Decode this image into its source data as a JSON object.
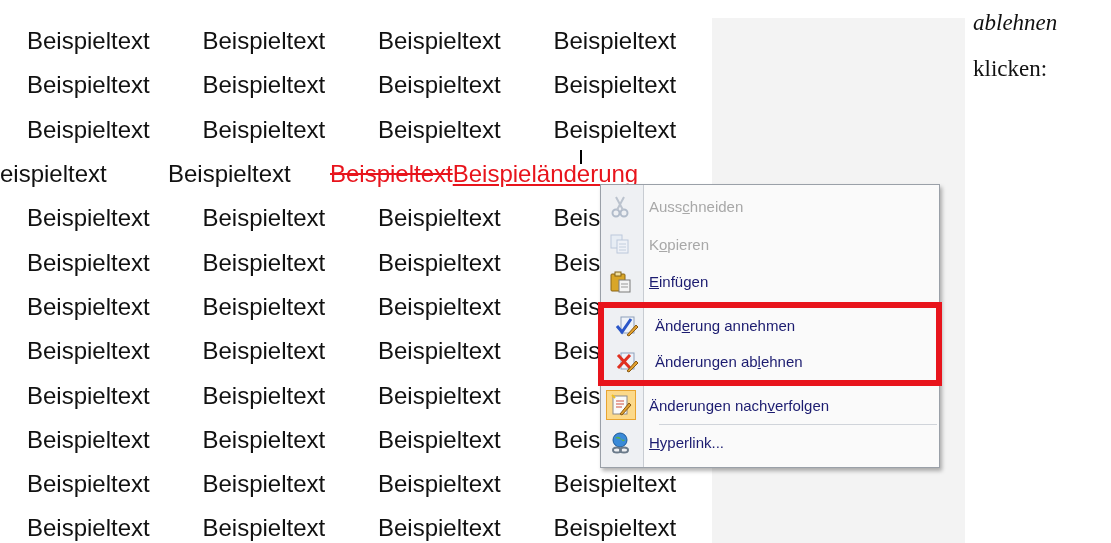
{
  "document": {
    "rows": [
      {
        "kind": "grid",
        "words": [
          {
            "text": "Beispieltext",
            "kind": "normal"
          },
          {
            "text": "Beispieltext",
            "kind": "normal"
          },
          {
            "text": "Beispieltext",
            "kind": "normal"
          },
          {
            "text": "Beispieltext",
            "kind": "normal"
          }
        ]
      },
      {
        "kind": "grid",
        "words": [
          {
            "text": "Beispieltext",
            "kind": "normal"
          },
          {
            "text": "Beispieltext",
            "kind": "normal"
          },
          {
            "text": "Beispieltext",
            "kind": "normal"
          },
          {
            "text": "Beispieltext",
            "kind": "normal"
          }
        ]
      },
      {
        "kind": "grid",
        "words": [
          {
            "text": "Beispieltext",
            "kind": "normal"
          },
          {
            "text": "Beispieltext",
            "kind": "normal"
          },
          {
            "text": "Beispieltext",
            "kind": "normal"
          },
          {
            "text": "Beispieltext",
            "kind": "normal"
          }
        ]
      },
      {
        "kind": "flow",
        "words": [
          {
            "text": "eispieltext",
            "kind": "normal"
          },
          {
            "text": "Beispieltext",
            "kind": "normal"
          },
          {
            "text": "Beispieltext",
            "kind": "deleted"
          },
          {
            "text": "Beispieländerung",
            "kind": "inserted"
          }
        ]
      },
      {
        "kind": "grid",
        "words": [
          {
            "text": "Beispieltext",
            "kind": "normal"
          },
          {
            "text": "Beispieltext",
            "kind": "normal"
          },
          {
            "text": "Beispieltext",
            "kind": "normal"
          },
          {
            "text": "Beis",
            "kind": "normal"
          }
        ]
      },
      {
        "kind": "grid",
        "words": [
          {
            "text": "Beispieltext",
            "kind": "normal"
          },
          {
            "text": "Beispieltext",
            "kind": "normal"
          },
          {
            "text": "Beispieltext",
            "kind": "normal"
          },
          {
            "text": "Beis",
            "kind": "normal"
          }
        ]
      },
      {
        "kind": "grid",
        "words": [
          {
            "text": "Beispieltext",
            "kind": "normal"
          },
          {
            "text": "Beispieltext",
            "kind": "normal"
          },
          {
            "text": "Beispieltext",
            "kind": "normal"
          },
          {
            "text": "Beis",
            "kind": "normal"
          }
        ]
      },
      {
        "kind": "grid",
        "words": [
          {
            "text": "Beispieltext",
            "kind": "normal"
          },
          {
            "text": "Beispieltext",
            "kind": "normal"
          },
          {
            "text": "Beispieltext",
            "kind": "normal"
          },
          {
            "text": "Beis",
            "kind": "normal"
          }
        ]
      },
      {
        "kind": "grid",
        "words": [
          {
            "text": "Beispieltext",
            "kind": "normal"
          },
          {
            "text": "Beispieltext",
            "kind": "normal"
          },
          {
            "text": "Beispieltext",
            "kind": "normal"
          },
          {
            "text": "Beis",
            "kind": "normal"
          }
        ]
      },
      {
        "kind": "grid",
        "words": [
          {
            "text": "Beispieltext",
            "kind": "normal"
          },
          {
            "text": "Beispieltext",
            "kind": "normal"
          },
          {
            "text": "Beispieltext",
            "kind": "normal"
          },
          {
            "text": "Beis",
            "kind": "normal"
          }
        ]
      },
      {
        "kind": "grid",
        "words": [
          {
            "text": "Beispieltext",
            "kind": "normal"
          },
          {
            "text": "Beispieltext",
            "kind": "normal"
          },
          {
            "text": "Beispieltext",
            "kind": "normal"
          },
          {
            "text": "Beispieltext",
            "kind": "normal"
          }
        ]
      },
      {
        "kind": "grid",
        "words": [
          {
            "text": "Beispieltext",
            "kind": "normal"
          },
          {
            "text": "Beispieltext",
            "kind": "normal"
          },
          {
            "text": "Beispieltext",
            "kind": "normal"
          },
          {
            "text": "Beispieltext",
            "kind": "normal"
          }
        ]
      }
    ]
  },
  "context_menu": {
    "items": [
      {
        "label_pre": "Auss",
        "label_key": "c",
        "label_post": "hneiden",
        "disabled": true,
        "checked": false,
        "highlighted": false,
        "separator_before": false
      },
      {
        "label_pre": "K",
        "label_key": "o",
        "label_post": "pieren",
        "disabled": true,
        "checked": false,
        "highlighted": false,
        "separator_before": false
      },
      {
        "label_key": "E",
        "label_post": "infügen",
        "disabled": false,
        "checked": false,
        "highlighted": false,
        "separator_before": false
      },
      {
        "label_pre": "Änd",
        "label_key": "e",
        "label_post": "rung annehmen",
        "disabled": false,
        "checked": false,
        "highlighted": true,
        "separator_before": false
      },
      {
        "label_pre": "Änderungen ab",
        "label_key": "l",
        "label_post": "ehnen",
        "disabled": false,
        "checked": false,
        "highlighted": true,
        "separator_before": false
      },
      {
        "label_pre": "Änderungen nach",
        "label_key": "v",
        "label_post": "erfolgen",
        "disabled": false,
        "checked": true,
        "highlighted": false,
        "separator_before": false
      },
      {
        "label_key": "H",
        "label_post": "yperlink...",
        "disabled": false,
        "checked": false,
        "highlighted": false,
        "separator_before": true
      }
    ]
  },
  "side_text": [
    {
      "text": "ablehnen",
      "italic": true
    },
    {
      "text": "klicken:",
      "italic": false
    }
  ]
}
